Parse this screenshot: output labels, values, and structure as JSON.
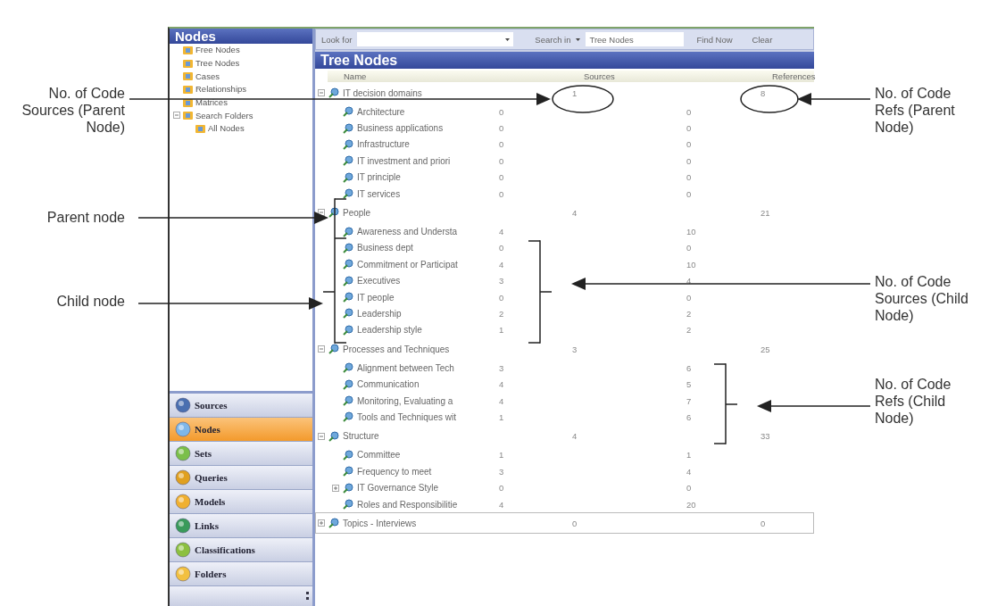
{
  "annotations": [
    {
      "text": "No. of  Code Sources (Parent Node)"
    },
    {
      "text": "Parent node"
    },
    {
      "text": "Child node"
    },
    {
      "text": "No. of Code Refs (Parent Node)"
    },
    {
      "text": "No. of Code Sources (Child Node)"
    },
    {
      "text": "No. of Code Refs (Child Node)"
    }
  ],
  "sidebar": {
    "title": "Nodes",
    "folders": [
      {
        "label": "Free Nodes",
        "selected": false
      },
      {
        "label": "Tree Nodes",
        "selected": false
      },
      {
        "label": "Cases",
        "selected": false
      },
      {
        "label": "Relationships",
        "selected": false
      },
      {
        "label": "Matrices",
        "selected": false
      },
      {
        "label": "Search Folders",
        "selected": false,
        "expanded": true,
        "children": [
          {
            "label": "All Nodes",
            "selected": false
          }
        ]
      }
    ],
    "nav": [
      {
        "label": "Sources",
        "selected": false
      },
      {
        "label": "Nodes",
        "selected": true
      },
      {
        "label": "Sets",
        "selected": false
      },
      {
        "label": "Queries",
        "selected": false
      },
      {
        "label": "Models",
        "selected": false
      },
      {
        "label": "Links",
        "selected": false
      },
      {
        "label": "Classifications",
        "selected": false
      },
      {
        "label": "Folders",
        "selected": false
      }
    ]
  },
  "find_bar": {
    "look_for_label": "Look for",
    "search_in_label": "Search in",
    "search_in_value": "Tree Nodes",
    "buttons": [
      "Find Now",
      "Clear"
    ]
  },
  "tree": {
    "title": "Tree Nodes",
    "columns": [
      "Name",
      "Sources",
      "References"
    ],
    "nodes": [
      {
        "name": "IT decision domains",
        "sources": "1",
        "references": "8",
        "expanded": true,
        "selected": false,
        "children": [
          {
            "name": "Architecture",
            "sources": "0",
            "references": "0",
            "selected": false
          },
          {
            "name": "Business applications",
            "sources": "0",
            "references": "0",
            "selected": false
          },
          {
            "name": "Infrastructure",
            "sources": "0",
            "references": "0",
            "selected": false
          },
          {
            "name": "IT investment and priori",
            "sources": "0",
            "references": "0",
            "selected": false
          },
          {
            "name": "IT principle",
            "sources": "0",
            "references": "0",
            "selected": false
          },
          {
            "name": "IT services",
            "sources": "0",
            "references": "0",
            "selected": false
          }
        ]
      },
      {
        "name": "People",
        "sources": "4",
        "references": "21",
        "expanded": true,
        "selected": false,
        "children": [
          {
            "name": "Awareness and Understa",
            "sources": "4",
            "references": "10",
            "selected": false
          },
          {
            "name": "Business dept",
            "sources": "0",
            "references": "0",
            "selected": false
          },
          {
            "name": "Commitment or Participat",
            "sources": "4",
            "references": "10",
            "selected": false
          },
          {
            "name": "Executives",
            "sources": "3",
            "references": "4",
            "selected": false
          },
          {
            "name": "IT people",
            "sources": "0",
            "references": "0",
            "selected": false
          },
          {
            "name": "Leadership",
            "sources": "2",
            "references": "2",
            "selected": false
          },
          {
            "name": "Leadership style",
            "sources": "1",
            "references": "2",
            "selected": false
          }
        ]
      },
      {
        "name": "Processes and Techniques",
        "sources": "3",
        "references": "25",
        "expanded": true,
        "selected": false,
        "children": [
          {
            "name": "Alignment between Tech",
            "sources": "3",
            "references": "6",
            "selected": false
          },
          {
            "name": "Communication",
            "sources": "4",
            "references": "5",
            "selected": false
          },
          {
            "name": "Monitoring, Evaluating a",
            "sources": "4",
            "references": "7",
            "selected": false
          },
          {
            "name": "Tools and Techniques wit",
            "sources": "1",
            "references": "6",
            "selected": false
          }
        ]
      },
      {
        "name": "Structure",
        "sources": "4",
        "references": "33",
        "expanded": true,
        "selected": false,
        "children": [
          {
            "name": "Committee",
            "sources": "1",
            "references": "1",
            "selected": false
          },
          {
            "name": "Frequency to meet",
            "sources": "3",
            "references": "4",
            "selected": false
          },
          {
            "name": "IT Governance Style",
            "sources": "0",
            "references": "0",
            "expanded": false,
            "selected": false
          },
          {
            "name": "Roles and Responsibilitie",
            "sources": "4",
            "references": "20",
            "selected": false
          }
        ]
      },
      {
        "name": "Topics - Interviews",
        "sources": "0",
        "references": "0",
        "expanded": false,
        "selected": true
      }
    ]
  }
}
